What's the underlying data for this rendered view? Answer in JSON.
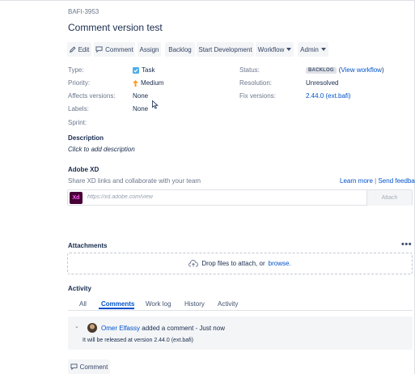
{
  "issue": {
    "key": "BAFI-3953",
    "summary": "Comment version test"
  },
  "toolbar": {
    "edit": "Edit",
    "comment": "Comment",
    "assign": "Assign",
    "backlog": "Backlog",
    "start_development": "Start Development",
    "workflow": "Workflow",
    "admin": "Admin"
  },
  "details": {
    "type_label": "Type:",
    "type_value": "Task",
    "priority_label": "Priority:",
    "priority_value": "Medium",
    "affects_label": "Affects versions:",
    "affects_value": "None",
    "labels_label": "Labels:",
    "labels_value": "None",
    "sprint_label": "Sprint:",
    "status_label": "Status:",
    "status_value": "BACKLOG",
    "view_workflow": "View workflow",
    "resolution_label": "Resolution:",
    "resolution_value": "Unresolved",
    "fix_label": "Fix versions:",
    "fix_value": "2.44.0 (ext.bafi)"
  },
  "description": {
    "title": "Description",
    "placeholder": "Click to add description"
  },
  "adobe_xd": {
    "title": "Adobe XD",
    "subtitle": "Share XD links and collaborate with your team",
    "learn_more": "Learn more",
    "separator": "|",
    "send_feedback": "Send feedback",
    "logo_text": "Xd",
    "input_placeholder": "https://xd.adobe.com/view",
    "attach": "Attach"
  },
  "attachments": {
    "title": "Attachments",
    "drop_text": "Drop files to attach, or",
    "browse": "browse."
  },
  "activity": {
    "title": "Activity",
    "tabs": [
      "All",
      "Comments",
      "Work log",
      "History",
      "Activity"
    ],
    "active_tab": "Comments"
  },
  "comment": {
    "author": "Omer Elfassy",
    "action": "added a comment - Just now",
    "body": "It will be released at version 2.44.0 (ext.bafi)"
  },
  "footer": {
    "comment_button": "Comment"
  },
  "colors": {
    "link": "#0052cc",
    "text": "#172b4d",
    "muted": "#6b778c",
    "button_bg": "#f4f5f7",
    "task_icon": "#4bade8",
    "priority_medium": "#ff991f"
  }
}
